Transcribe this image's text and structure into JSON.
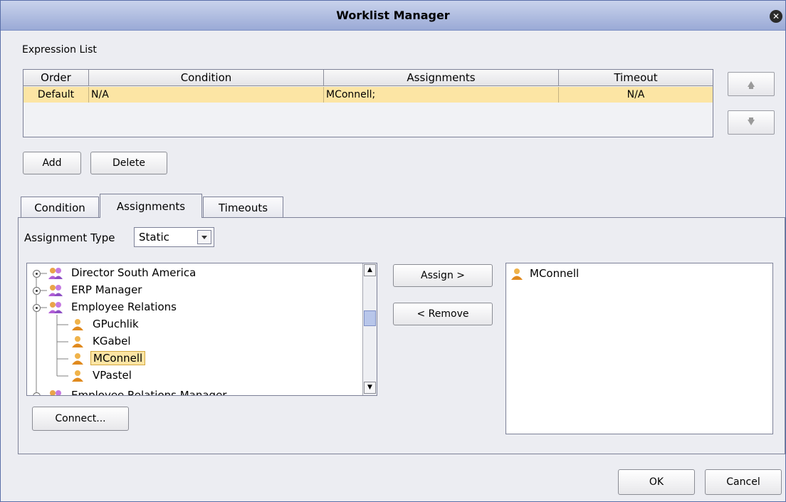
{
  "window": {
    "title": "Worklist Manager"
  },
  "expression_list": {
    "label": "Expression List",
    "columns": [
      "Order",
      "Condition",
      "Assignments",
      "Timeout"
    ],
    "rows": [
      {
        "order": "Default",
        "condition": "N/A",
        "assignments": "MConnell;",
        "timeout": "N/A"
      }
    ]
  },
  "buttons": {
    "add": "Add",
    "delete": "Delete",
    "assign": "Assign >",
    "remove": "< Remove",
    "connect": "Connect...",
    "ok": "OK",
    "cancel": "Cancel"
  },
  "tabs": [
    {
      "label": "Condition"
    },
    {
      "label": "Assignments"
    },
    {
      "label": "Timeouts"
    }
  ],
  "assignment_type": {
    "label": "Assignment Type",
    "value": "Static"
  },
  "tree": {
    "nodes": [
      {
        "label": "Director South America"
      },
      {
        "label": "ERP Manager"
      },
      {
        "label": "Employee Relations"
      },
      {
        "label": "GPuchlik"
      },
      {
        "label": "KGabel"
      },
      {
        "label": "MConnell"
      },
      {
        "label": "VPastel"
      },
      {
        "label": "Employee Relations Manager"
      }
    ]
  },
  "assigned_list": {
    "items": [
      "MConnell"
    ]
  },
  "icons": [
    "close-icon",
    "arrow-up-icon",
    "arrow-down-icon",
    "group-icon",
    "user-icon",
    "dropdown-icon",
    "scroll-up-icon",
    "scroll-down-icon"
  ],
  "colors": {
    "selected_row": "#fce5a4",
    "title_bar": "#b3c0e3",
    "selected_node": "#fce5a4"
  }
}
